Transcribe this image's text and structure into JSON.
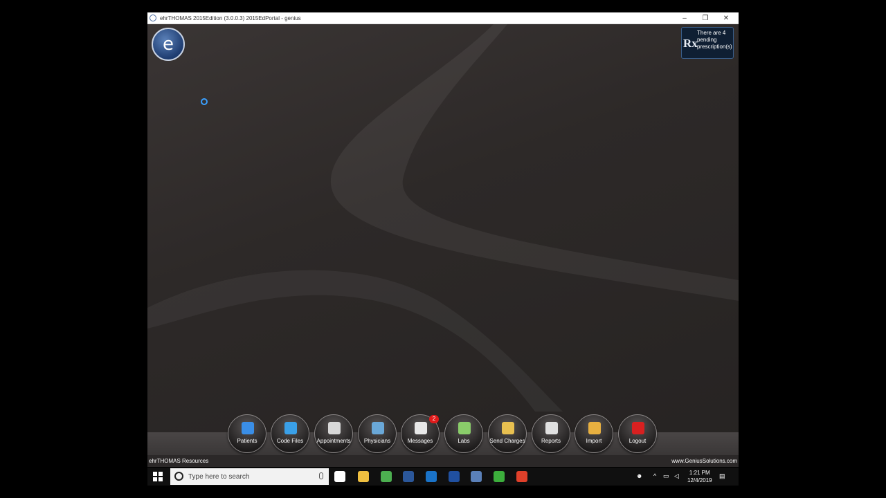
{
  "window": {
    "title": "ehrTHOMAS 2015Edition (3.0.0.3) 2015EdPortal - genius",
    "minimize": "–",
    "maximize": "❐",
    "close": "✕"
  },
  "app": {
    "logo_text": "e",
    "prescription_alert": "There are 4 pending prescription(s)",
    "rx_symbol": "Rx"
  },
  "dock": {
    "buttons": [
      {
        "label": "Patients",
        "icon": "patients-icon",
        "color": "#3a8ee6"
      },
      {
        "label": "Code Files",
        "icon": "code-files-icon",
        "color": "#3aa0e8"
      },
      {
        "label": "Appointments",
        "icon": "calendar-icon",
        "color": "#d8d8d8"
      },
      {
        "label": "Physicians",
        "icon": "stethoscope-icon",
        "color": "#6aa8d8"
      },
      {
        "label": "Messages",
        "icon": "document-icon",
        "color": "#e8e8e8",
        "badge": "2"
      },
      {
        "label": "Labs",
        "icon": "flask-icon",
        "color": "#8acd6a"
      },
      {
        "label": "Send Charges",
        "icon": "send-charges-icon",
        "color": "#e8c050"
      },
      {
        "label": "Reports",
        "icon": "report-icon",
        "color": "#e0e0e0"
      },
      {
        "label": "Import",
        "icon": "import-icon",
        "color": "#e8b040"
      },
      {
        "label": "Logout",
        "icon": "power-icon",
        "color": "#d82020"
      }
    ]
  },
  "footer": {
    "left": "ehrTHOMAS Resources",
    "right": "www.GeniusSolutions.com"
  },
  "taskbar": {
    "search_placeholder": "Type here to search",
    "time": "1:21 PM",
    "date": "12/4/2019",
    "pinned": [
      {
        "name": "task-view-icon",
        "color": "#ffffff"
      },
      {
        "name": "file-explorer-icon",
        "color": "#f0c040"
      },
      {
        "name": "chrome-icon",
        "color": "#4caf50"
      },
      {
        "name": "word-icon",
        "color": "#2b579a"
      },
      {
        "name": "outlook-icon",
        "color": "#1a73c8"
      },
      {
        "name": "genius-app-icon",
        "color": "#2050a0"
      },
      {
        "name": "ehr-app-icon",
        "color": "#5a80b8"
      },
      {
        "name": "camtasia-icon",
        "color": "#3cae3c"
      },
      {
        "name": "recorder-icon",
        "color": "#e0402a"
      }
    ]
  }
}
